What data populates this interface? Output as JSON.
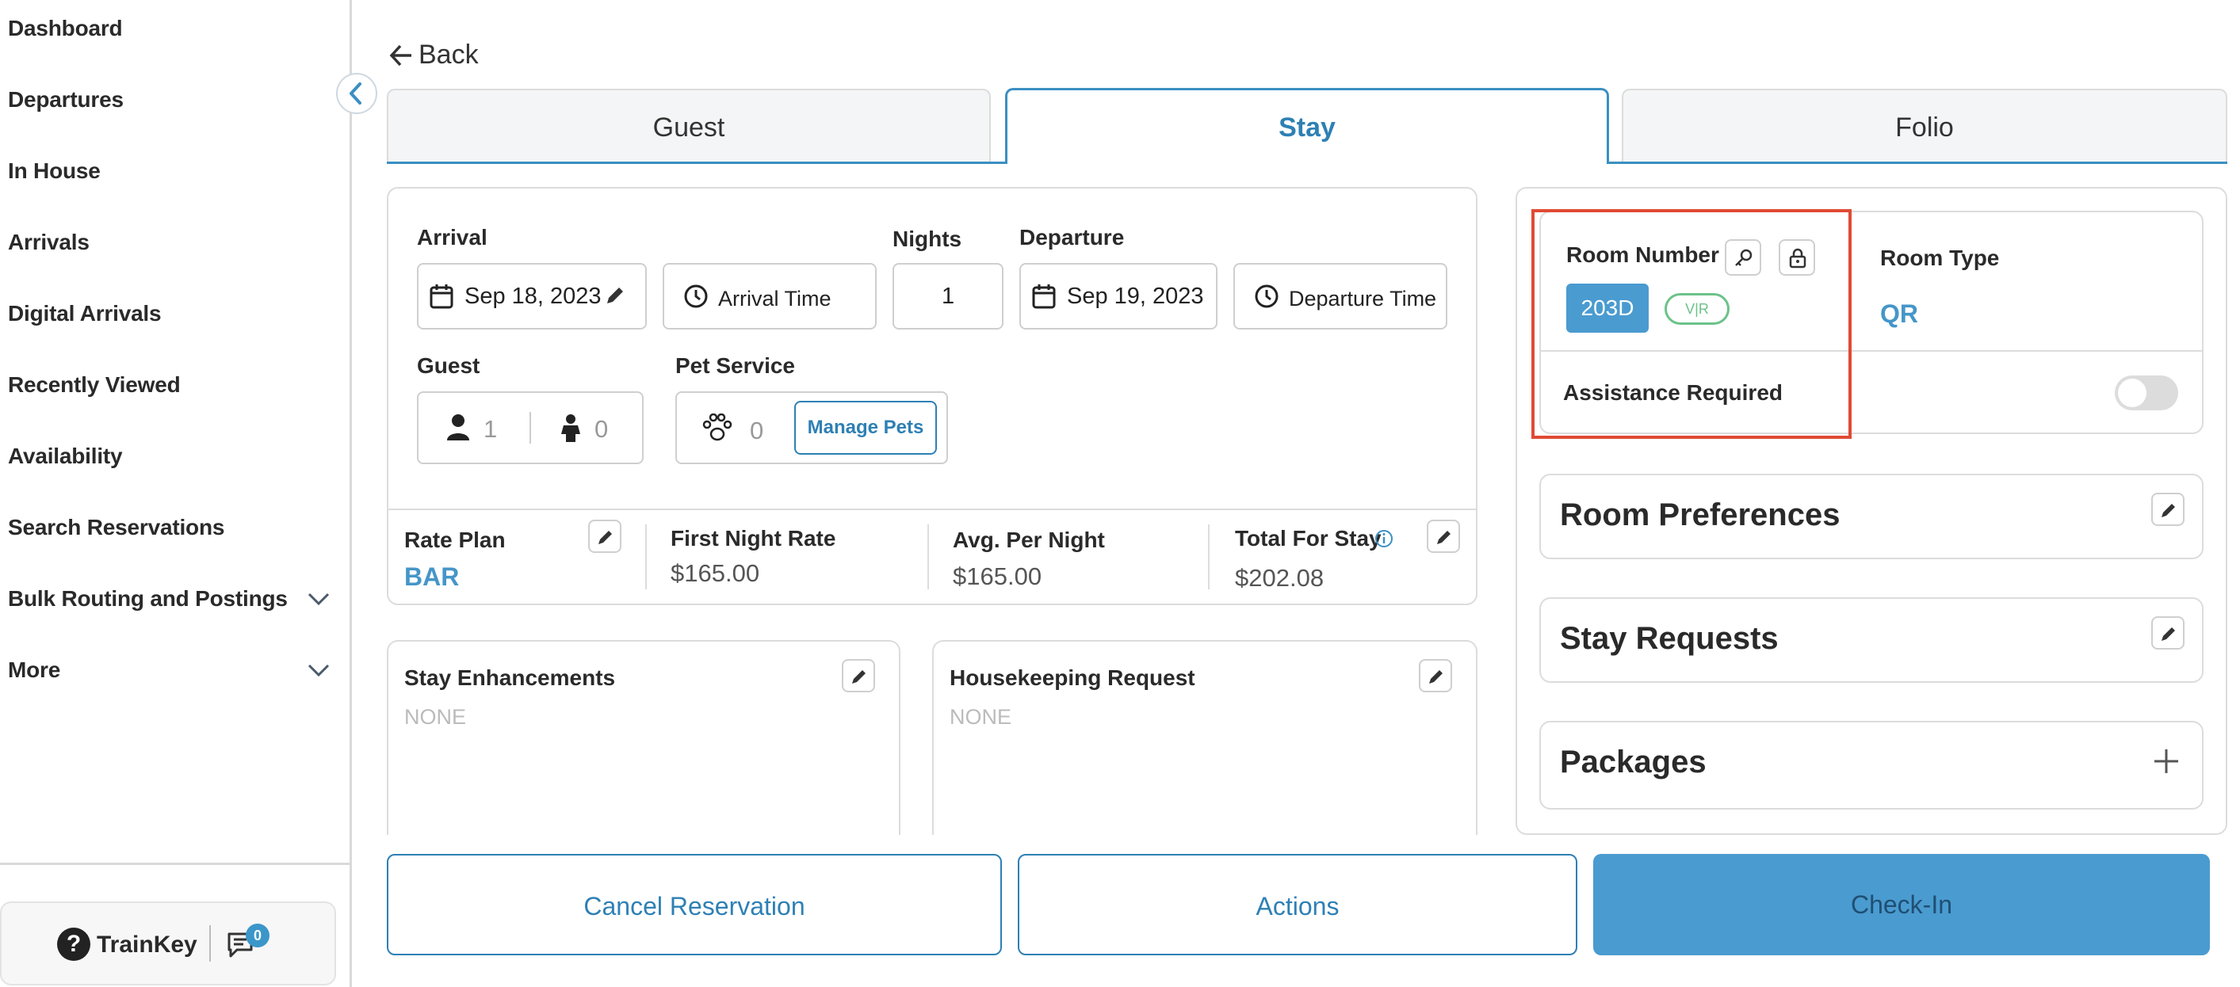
{
  "sidebar": {
    "items": [
      {
        "label": "Dashboard"
      },
      {
        "label": "Departures"
      },
      {
        "label": "In House"
      },
      {
        "label": "Arrivals"
      },
      {
        "label": "Digital Arrivals"
      },
      {
        "label": "Recently Viewed"
      },
      {
        "label": "Availability"
      },
      {
        "label": "Search Reservations"
      },
      {
        "label": "Bulk Routing and Postings"
      },
      {
        "label": "More"
      }
    ],
    "trainkey_label": "TrainKey",
    "message_count": "0"
  },
  "header": {
    "back_label": "Back"
  },
  "tabs": [
    {
      "label": "Guest"
    },
    {
      "label": "Stay"
    },
    {
      "label": "Folio"
    }
  ],
  "stay": {
    "arrival_label": "Arrival",
    "arrival_date": "Sep 18, 2023",
    "arrival_time_label": "Arrival Time",
    "nights_label": "Nights",
    "nights_value": "1",
    "departure_label": "Departure",
    "departure_date": "Sep 19, 2023",
    "departure_time_label": "Departure Time",
    "guest_label": "Guest",
    "adults": "1",
    "children": "0",
    "pet_service_label": "Pet Service",
    "pets": "0",
    "manage_pets_label": "Manage Pets",
    "rate_plan_label": "Rate Plan",
    "rate_plan_value": "BAR",
    "first_night_rate_label": "First Night Rate",
    "first_night_rate_value": "$165.00",
    "avg_per_night_label": "Avg. Per Night",
    "avg_per_night_value": "$165.00",
    "total_for_stay_label": "Total For Stay",
    "total_for_stay_value": "$202.08",
    "stay_enhancements_label": "Stay Enhancements",
    "stay_enhancements_value": "NONE",
    "housekeeping_label": "Housekeeping Request",
    "housekeeping_value": "NONE"
  },
  "room": {
    "room_number_label": "Room Number",
    "room_number": "203D",
    "room_status": "V|R",
    "room_type_label": "Room Type",
    "room_type": "QR",
    "assistance_label": "Assistance Required",
    "room_preferences_label": "Room Preferences",
    "stay_requests_label": "Stay Requests",
    "packages_label": "Packages"
  },
  "actions": {
    "cancel_label": "Cancel Reservation",
    "actions_label": "Actions",
    "checkin_label": "Check-In"
  },
  "colors": {
    "accent": "#2e80b4",
    "primary_button": "#4a9bd0",
    "highlight": "#e04a35"
  }
}
